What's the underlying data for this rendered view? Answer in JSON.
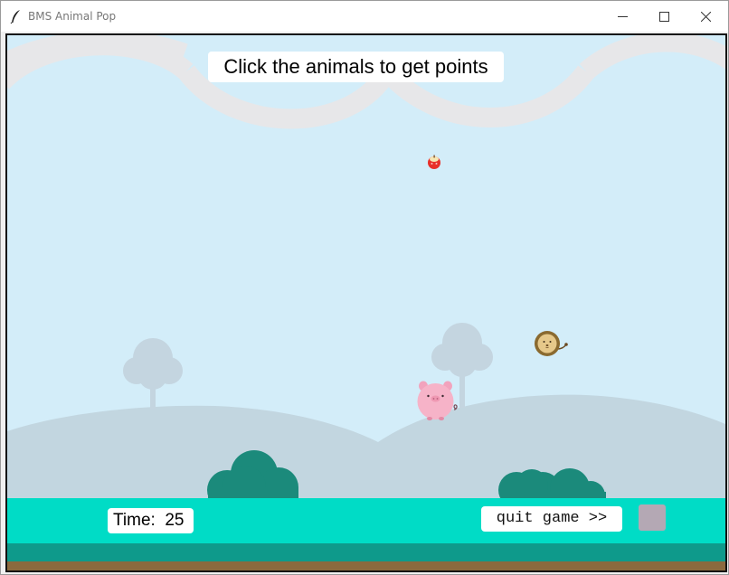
{
  "window": {
    "title": "BMS Animal Pop",
    "icons": {
      "app": "feather-icon",
      "minimize": "minimize-icon",
      "maximize": "maximize-icon",
      "close": "close-icon"
    }
  },
  "game": {
    "instruction": "Click the animals to get points",
    "timer_text": "Time:  25",
    "quit_label": "quit game >>",
    "animals": [
      {
        "kind": "apple",
        "name": "apple-animal"
      },
      {
        "kind": "lion",
        "name": "lion-animal"
      },
      {
        "kind": "pig",
        "name": "pig-animal"
      }
    ]
  },
  "colors": {
    "sky": "#d3edf9",
    "cloud_band": "#e7e7e9",
    "hill_back": "#c2d6e0",
    "tree": "#c4d5e0",
    "bush": "#1b8a7b",
    "ground_top": "#00dcc6",
    "ground_mid": "#0e9a8b",
    "dirt": "#8b6a3e",
    "quit_square": "#b4a8b4"
  }
}
